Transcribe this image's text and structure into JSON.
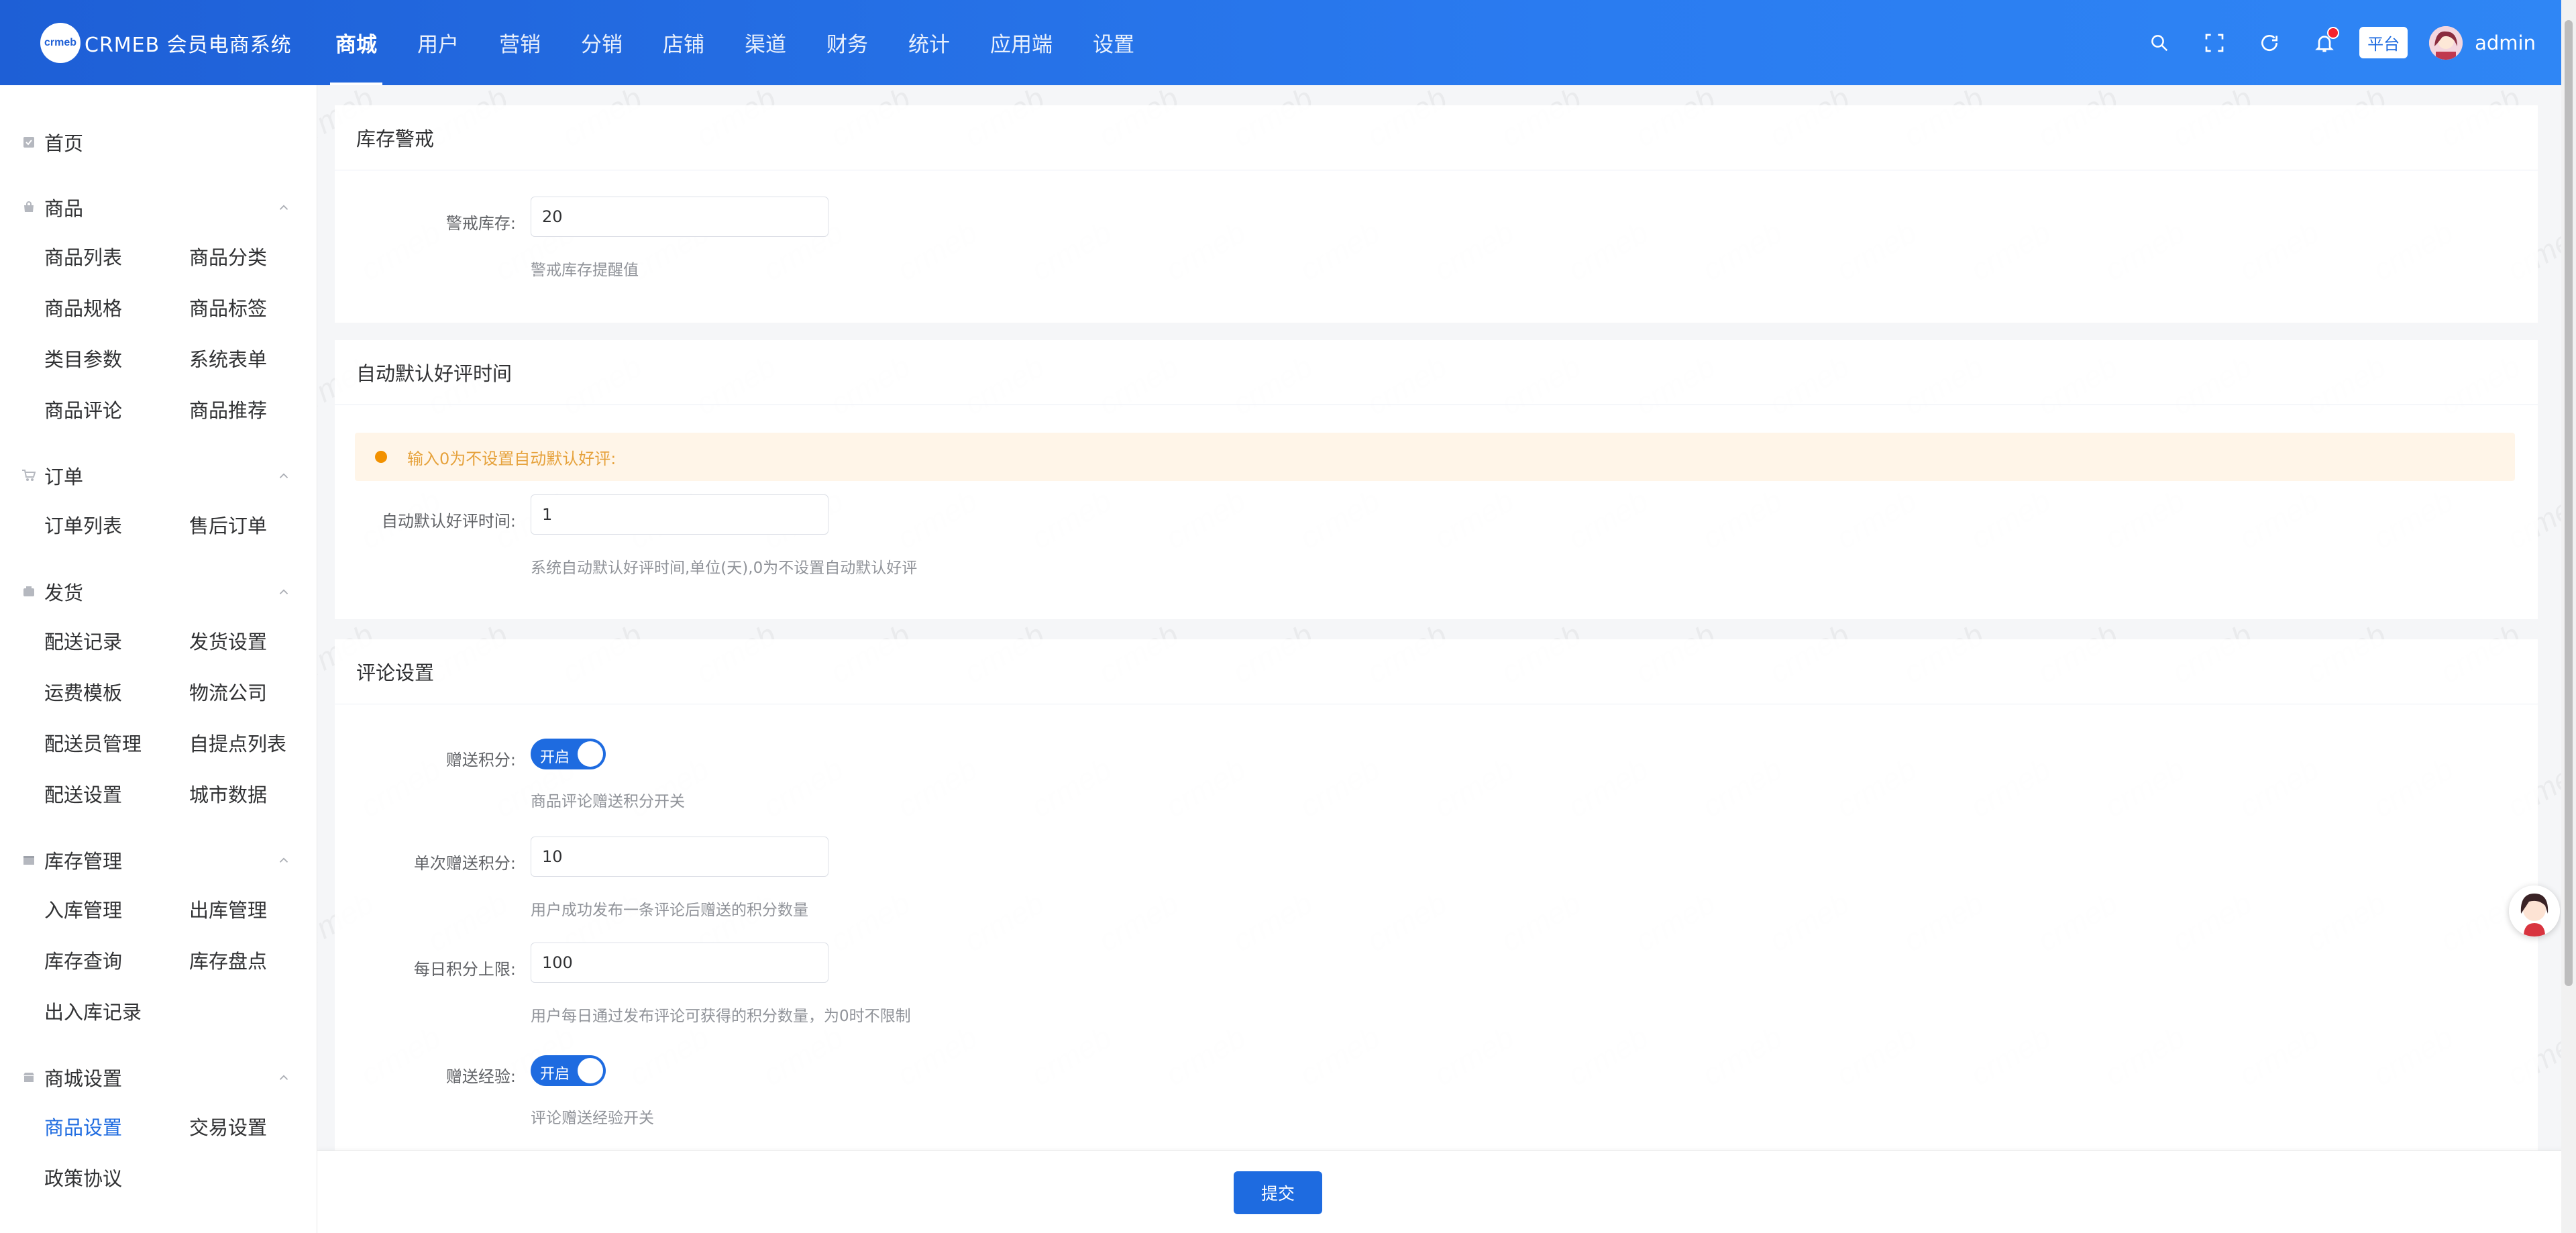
{
  "brand": {
    "logo_text": "crmeb",
    "name": "CRMEB 会员电商系统"
  },
  "topnav": [
    {
      "label": "商城",
      "active": true
    },
    {
      "label": "用户"
    },
    {
      "label": "营销"
    },
    {
      "label": "分销"
    },
    {
      "label": "店铺"
    },
    {
      "label": "渠道"
    },
    {
      "label": "财务"
    },
    {
      "label": "统计"
    },
    {
      "label": "应用端"
    },
    {
      "label": "设置"
    }
  ],
  "toolbar": {
    "platform": "平台",
    "user": "admin"
  },
  "sidebar": {
    "home": "首页",
    "goods": {
      "title": "商品",
      "items": [
        "商品列表",
        "商品分类",
        "商品规格",
        "商品标签",
        "类目参数",
        "系统表单",
        "商品评论",
        "商品推荐"
      ]
    },
    "order": {
      "title": "订单",
      "items": [
        "订单列表",
        "售后订单"
      ]
    },
    "delivery": {
      "title": "发货",
      "items": [
        "配送记录",
        "发货设置",
        "运费模板",
        "物流公司",
        "配送员管理",
        "自提点列表",
        "配送设置",
        "城市数据"
      ]
    },
    "stock": {
      "title": "库存管理",
      "items": [
        "入库管理",
        "出库管理",
        "库存查询",
        "库存盘点",
        "出入库记录"
      ]
    },
    "mall": {
      "title": "商城设置",
      "items": [
        "商品设置",
        "交易设置",
        "政策协议"
      ],
      "active": "商品设置"
    }
  },
  "watermark": "crmeb",
  "stock_warning": {
    "title": "库存警戒",
    "label": "警戒库存:",
    "value": "20",
    "help": "警戒库存提醒值"
  },
  "auto_review": {
    "title": "自动默认好评时间",
    "alert": "输入0为不设置自动默认好评:",
    "label": "自动默认好评时间:",
    "value": "1",
    "help": "系统自动默认好评时间,单位(天),0为不设置自动默认好评"
  },
  "review_settings": {
    "title": "评论设置",
    "points_label": "赠送积分:",
    "points_switch": "开启",
    "points_help": "商品评论赠送积分开关",
    "single_label": "单次赠送积分:",
    "single_value": "10",
    "single_help": "用户成功发布一条评论后赠送的积分数量",
    "daily_label": "每日积分上限:",
    "daily_value": "100",
    "daily_help": "用户每日通过发布评论可获得的积分数量，为0时不限制",
    "exp_label": "赠送经验:",
    "exp_switch": "开启",
    "exp_help": "评论赠送经验开关"
  },
  "submit": "提交",
  "colors": {
    "primary": "#1e6be0",
    "header_from": "#1e5fd6",
    "header_to": "#2f86f5",
    "warning": "#f29100"
  }
}
